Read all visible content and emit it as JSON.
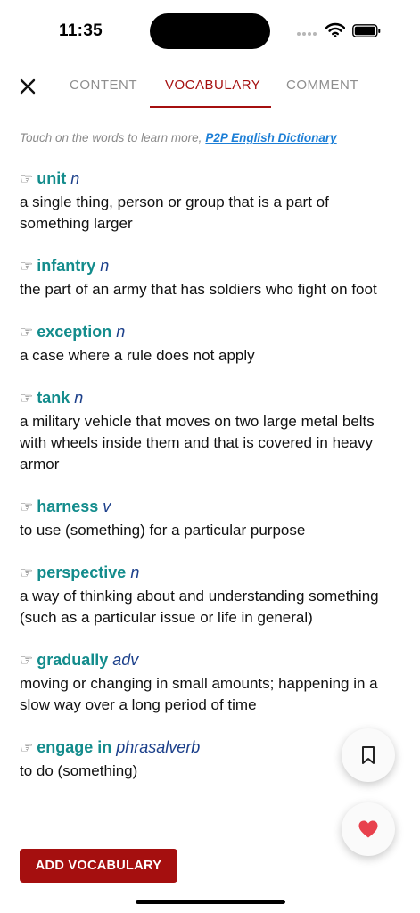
{
  "status_bar": {
    "time": "11:35"
  },
  "tabs": [
    {
      "label": "CONTENT"
    },
    {
      "label": "VOCABULARY"
    },
    {
      "label": "COMMENT"
    }
  ],
  "hint": {
    "text": "Touch on the words to learn more,",
    "link": "P2P English Dictionary"
  },
  "vocabulary": [
    {
      "word": "unit",
      "pos": "n",
      "definition": "a single thing, person or group that is a part of something larger"
    },
    {
      "word": "infantry",
      "pos": "n",
      "definition": "the part of an army that has soldiers who fight on foot"
    },
    {
      "word": "exception",
      "pos": "n",
      "definition": "a case where a rule does not apply"
    },
    {
      "word": "tank",
      "pos": "n",
      "definition": "a military vehicle that moves on two large metal belts with wheels inside them and that is covered in heavy armor"
    },
    {
      "word": "harness",
      "pos": "v",
      "definition": "to use (something) for a particular purpose"
    },
    {
      "word": "perspective",
      "pos": "n",
      "definition": "a way of thinking about and understanding something (such as a particular issue or life in general)"
    },
    {
      "word": "gradually",
      "pos": "adv",
      "definition": "moving or changing in small amounts; happening in a slow way over a long period of time"
    },
    {
      "word": "engage in",
      "pos": "phrasalverb",
      "definition": "to do (something)"
    }
  ],
  "add_button": {
    "label": "ADD VOCABULARY"
  },
  "colors": {
    "accent": "#a50f0f",
    "word": "#138c8c",
    "pos": "#1b3f8a",
    "link": "#1d7fd6"
  }
}
